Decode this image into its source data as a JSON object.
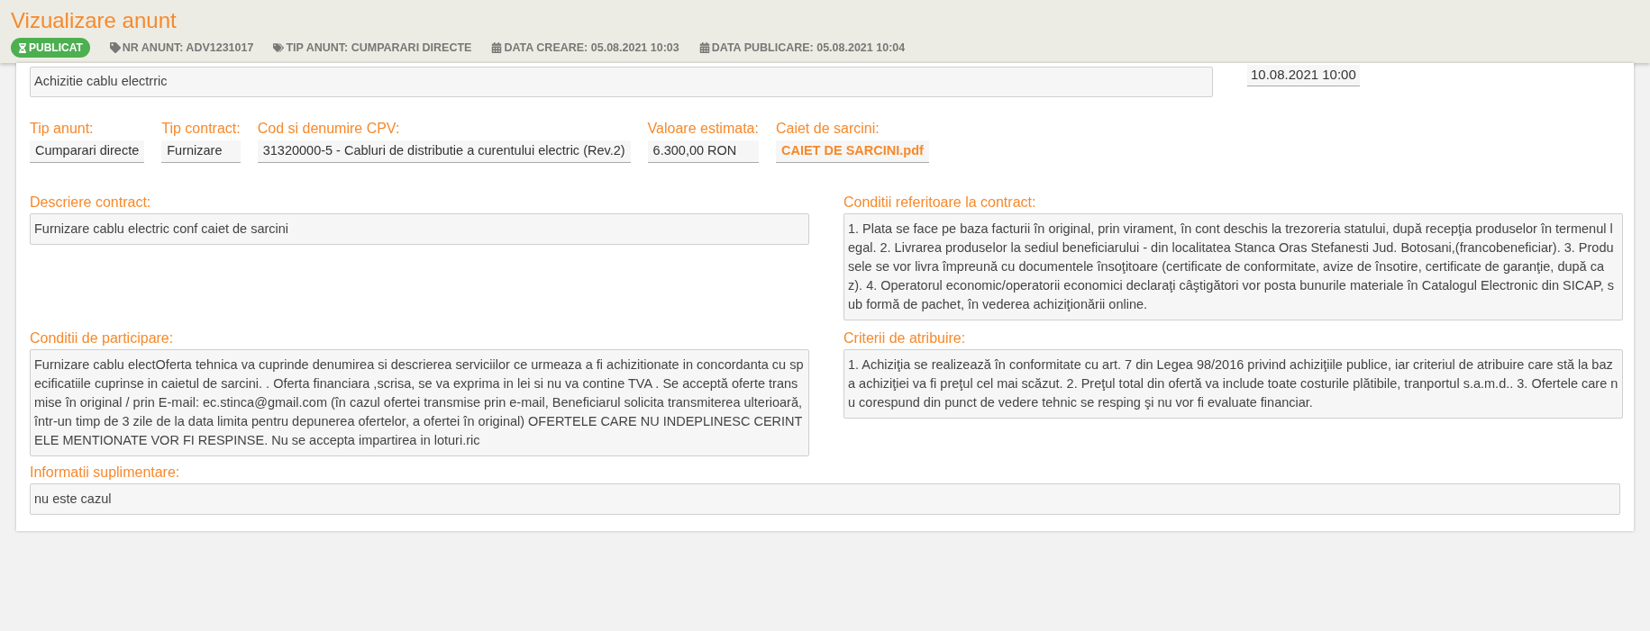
{
  "header": {
    "title": "Vizualizare anunt",
    "status": "PUBLICAT",
    "meta": [
      {
        "kind": "tag",
        "text": "NR ANUNT: ADV1231017"
      },
      {
        "kind": "tags",
        "text": "TIP ANUNT: CUMPARARI DIRECTE"
      },
      {
        "kind": "calendar",
        "text": "DATA CREARE: 05.08.2021 10:03"
      },
      {
        "kind": "calendar",
        "text": "DATA PUBLICARE: 05.08.2021 10:04"
      }
    ]
  },
  "form": {
    "title_value": "Achizitie cablu electrric",
    "deadline_value": "10.08.2021 10:00",
    "fields": [
      {
        "kind": "text",
        "label": "Tip anunt:",
        "value": "Cumparari directe"
      },
      {
        "kind": "text",
        "label": "Tip contract:",
        "value": "Furnizare"
      },
      {
        "kind": "text",
        "label": "Cod si denumire CPV:",
        "value": "31320000-5 - Cabluri de distributie a curentului electric (Rev.2)"
      },
      {
        "kind": "text",
        "label": "Valoare estimata:",
        "value": "6.300,00  RON"
      },
      {
        "kind": "link",
        "label": "Caiet de sarcini:",
        "value": "CAIET DE SARCINI.pdf"
      }
    ],
    "rows": [
      [
        {
          "label": "Descriere contract:",
          "value": "Furnizare cablu electric conf caiet de sarcini"
        },
        {
          "label": "Conditii referitoare la contract:",
          "value": "1. Plata se face pe baza facturii în original, prin virament, în cont deschis la trezoreria statului, după recepţia produselor în termenul legal. 2. Livrarea produselor la sediul beneficiarului - din localitatea Stanca Oras Stefanesti Jud. Botosani,(francobeneficiar). 3. Produsele se vor livra împreună cu documentele însoţitoare (certificate de conformitate, avize de însotire, certificate de garanţie, după caz). 4. Operatorul economic/operatorii economici declaraţi câştigători vor posta bunurile materiale în Catalogul Electronic din SICAP, sub formă de pachet, în vederea achiziţionării online."
        }
      ],
      [
        {
          "label": "Conditii de participare:",
          "value": "Furnizare cablu electOferta tehnica va cuprinde denumirea si descrierea serviciilor ce urmeaza a fi achizitionate in concordanta cu specificatiile cuprinse in caietul de sarcini. . Oferta financiara ,scrisa, se va exprima in lei si nu va contine TVA . Se acceptă oferte transmise în original / prin E-mail: ec.stinca@gmail.com (în cazul ofertei transmise prin e-mail, Beneficiarul solicita transmiterea ulterioară, într-un timp de 3 zile de la data limita pentru depunerea ofertelor, a ofertei în original) OFERTELE CARE NU INDEPLINESC CERINTELE MENTIONATE VOR FI RESPINSE. Nu se accepta impartirea in loturi.ric"
        },
        {
          "label": "Criterii de atribuire:",
          "value": "1. Achiziţia se realizează în conformitate cu art. 7 din Legea 98/2016 privind achiziţiile publice, iar criteriul de atribuire care stă la baza achiziţiei va fi preţul cel mai scăzut. 2. Preţul total din ofertă va include toate costurile plătibile, tranportul s.a.m.d.. 3. Ofertele care nu corespund din punct de vedere tehnic se resping şi nu vor fi evaluate financiar."
        }
      ]
    ],
    "extra": {
      "label": "Informatii suplimentare:",
      "value": "nu este cazul"
    }
  }
}
